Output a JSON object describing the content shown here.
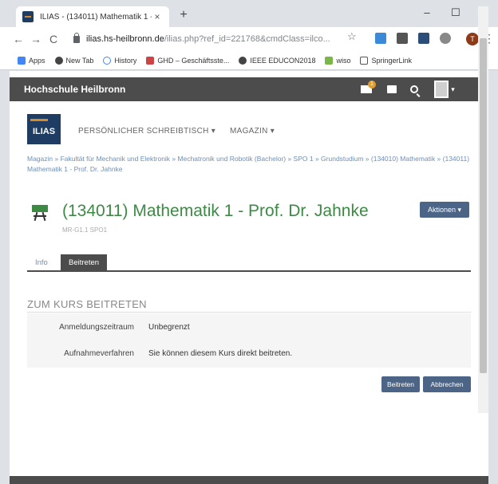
{
  "browser": {
    "tab_title": "ILIAS - (134011) Mathematik 1 - ...",
    "tab_close": "×",
    "new_tab": "+",
    "window_minimize": "–",
    "window_maximize": "☐",
    "window_close": "✕",
    "nav_back": "←",
    "nav_forward": "→",
    "nav_reload": "C",
    "url_host": "ilias.hs-heilbronn.de",
    "url_path": "/ilias.php?ref_id=221768&cmdClass=ilco...",
    "star": "☆",
    "profile_initial": "T",
    "menu": "⋮",
    "bookmarks": [
      "Apps",
      "New Tab",
      "History",
      "GHD – Geschäftsste...",
      "IEEE EDUCON2018",
      "wiso",
      "SpringerLink"
    ]
  },
  "topbar": {
    "title": "Hochschule Heilbronn",
    "mail_badge": "1",
    "caret": "▾"
  },
  "logo": {
    "text": "ILIAS"
  },
  "mainnav": {
    "desktop": "PERSÖNLICHER SCHREIBTISCH ▾",
    "magazine": "MAGAZIN ▾"
  },
  "breadcrumb": {
    "text": "Magazin » Fakultät für Mechanik und Elektronik » Mechatronik und Robotik (Bachelor) » SPO 1 » Grundstudium » (134010) Mathematik » (134011) Mathematik 1 - Prof. Dr. Jahnke"
  },
  "course": {
    "title": "(134011) Mathematik 1 - Prof. Dr. Jahnke",
    "subtitle": "MR-G1.1 SPO1",
    "actions": "Aktionen ▾"
  },
  "tabs": {
    "info": "Info",
    "join": "Beitreten"
  },
  "join_form": {
    "heading": "ZUM KURS BEITRETEN",
    "rows": [
      {
        "label": "Anmeldungszeitraum",
        "value": "Unbegrenzt"
      },
      {
        "label": "Aufnahmeverfahren",
        "value": "Sie können diesem Kurs direkt beitreten."
      }
    ],
    "join_button": "Beitreten",
    "cancel_button": "Abbrechen"
  },
  "colors": {
    "accent_green": "#3d8a45",
    "button_blue": "#4c6586",
    "topbar_gray": "#4c4c4c",
    "link_blue": "#6f8fb7"
  }
}
